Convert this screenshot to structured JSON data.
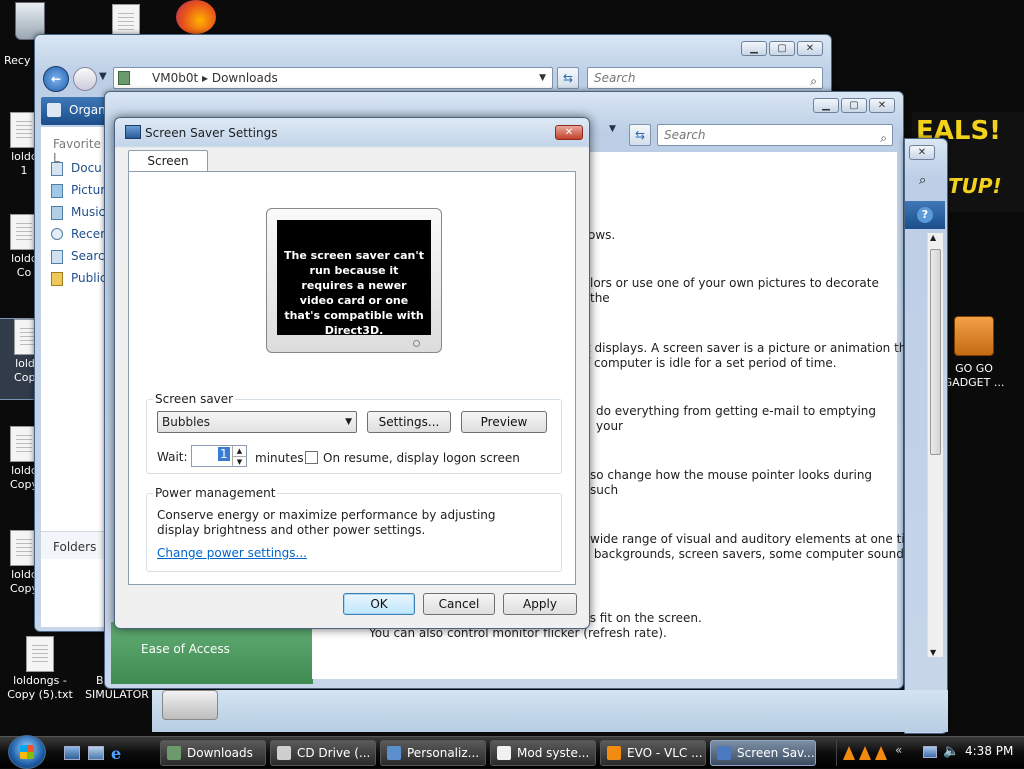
{
  "desktop": {
    "icons": [
      {
        "label": "Recy"
      },
      {
        "label": "loldc\n1"
      },
      {
        "label": "loldc\nCo"
      },
      {
        "label": "loldc\nCopy"
      },
      {
        "label": "loldc\nCopy"
      },
      {
        "label": "loldc\nCopy"
      },
      {
        "label": "loldongs -\nCopy (5).txt"
      },
      {
        "label": "BOSNIA\nSIMULATOR"
      },
      {
        "label": "GO GO\nGADGET ..."
      }
    ],
    "ad_text_1": "EALS!",
    "ad_text_2": "TUP!"
  },
  "explorer": {
    "path_computer": "VM0b0t",
    "path_folder": "Downloads",
    "search_placeholder": "Search",
    "organize_label": "Organ",
    "favorites_header": "Favorite L",
    "nav_items": [
      "Docu",
      "Pictur",
      "Music",
      "Recen",
      "Search",
      "Public"
    ],
    "folders_label": "Folders"
  },
  "control_panel": {
    "search_placeholder": "Search",
    "sidebar_bottom": "Ease of Access",
    "paragraphs": [
      "ows.",
      "lors or use one of your own pictures to decorate the",
      "t displays. A screen saver is a picture or animation that\nf computer is idle for a set period of time.",
      "do everything from getting e-mail to emptying your",
      "so change how the mouse pointer looks during such",
      "wide range of visual and auditory elements at one time\n backgrounds, screen savers, some computer sounds,",
      "nges the view so more or fewer items fit on the screen.\nYou can also control monitor flicker (refresh rate)."
    ]
  },
  "dialog": {
    "title": "Screen Saver Settings",
    "tab": "Screen Saver",
    "preview_message": "The screen saver can't run because it requires a newer video card or one that's compatible with Direct3D.",
    "screensaver_group": "Screen saver",
    "selected": "Bubbles",
    "settings_button": "Settings...",
    "preview_button": "Preview",
    "wait_label": "Wait:",
    "wait_value": "1",
    "minutes_label": "minutes",
    "resume_label": "On resume, display logon screen",
    "power_group": "Power management",
    "power_text": "Conserve energy or maximize performance by adjusting display brightness and other power settings.",
    "power_link": "Change power settings...",
    "ok": "OK",
    "cancel": "Cancel",
    "apply": "Apply"
  },
  "taskbar": {
    "tasks": [
      "Downloads",
      "CD Drive (...",
      "Personaliz...",
      "Mod syste...",
      "EVO - VLC ...",
      "Screen Sav..."
    ],
    "clock": "4:38 PM"
  },
  "colors": {
    "link": "#0066cc",
    "ad_yellow": "#f3d21b",
    "control_panel_green": "#5aa36b"
  }
}
